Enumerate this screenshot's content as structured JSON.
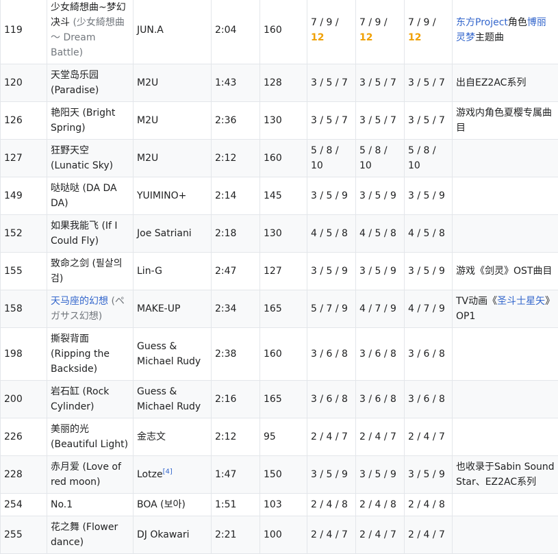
{
  "rows": [
    {
      "no": "119",
      "title": "少女綺想曲~梦幻决斗",
      "sub": "(少女綺想曲 ～ Dream Battle)",
      "link": false,
      "artist": "JUN.A",
      "ref": "",
      "time": "2:04",
      "bpm": "160",
      "diff1": "7 / 9 /",
      "diff1b": "12",
      "diff2": "7 / 9 /",
      "diff2b": "12",
      "diff3": "7 / 9 /",
      "diff3b": "12",
      "note_a": "东方Project",
      "note_b": "角色",
      "note_c": "博丽灵梦",
      "note_d": "主题曲"
    },
    {
      "no": "120",
      "title": "天堂岛乐园",
      "sub": "(Paradise)",
      "link": false,
      "artist": "M2U",
      "ref": "",
      "time": "1:43",
      "bpm": "128",
      "diff1": "3 / 5 / 7",
      "diff1b": "",
      "diff2": "3 / 5 / 7",
      "diff2b": "",
      "diff3": "3 / 5 / 7",
      "diff3b": "",
      "note_a": "",
      "note_b": "出自EZ2AC系列",
      "note_c": "",
      "note_d": ""
    },
    {
      "no": "126",
      "title": "艳阳天",
      "sub": "(Bright Spring)",
      "link": false,
      "artist": "M2U",
      "ref": "",
      "time": "2:36",
      "bpm": "130",
      "diff1": "3 / 5 / 7",
      "diff1b": "",
      "diff2": "3 / 5 / 7",
      "diff2b": "",
      "diff3": "3 / 5 / 7",
      "diff3b": "",
      "note_a": "",
      "note_b": "游戏内角色夏樱专属曲目",
      "note_c": "",
      "note_d": ""
    },
    {
      "no": "127",
      "title": "狂野天空",
      "sub": "(Lunatic Sky)",
      "link": false,
      "artist": "M2U",
      "ref": "",
      "time": "2:12",
      "bpm": "160",
      "diff1": "5 / 8 / 10",
      "diff1b": "",
      "diff2": "5 / 8 / 10",
      "diff2b": "",
      "diff3": "5 / 8 / 10",
      "diff3b": "",
      "note_a": "",
      "note_b": "",
      "note_c": "",
      "note_d": ""
    },
    {
      "no": "149",
      "title": "哒哒哒",
      "sub": "(DA DA DA)",
      "link": false,
      "artist": "YUIMINO+",
      "ref": "",
      "time": "2:14",
      "bpm": "145",
      "diff1": "3 / 5 / 9",
      "diff1b": "",
      "diff2": "3 / 5 / 9",
      "diff2b": "",
      "diff3": "3 / 5 / 9",
      "diff3b": "",
      "note_a": "",
      "note_b": "",
      "note_c": "",
      "note_d": ""
    },
    {
      "no": "152",
      "title": "如果我能飞",
      "sub": "(If I Could Fly)",
      "link": false,
      "artist": "Joe Satriani",
      "ref": "",
      "time": "2:18",
      "bpm": "130",
      "diff1": "4 / 5 / 8",
      "diff1b": "",
      "diff2": "4 / 5 / 8",
      "diff2b": "",
      "diff3": "4 / 5 / 8",
      "diff3b": "",
      "note_a": "",
      "note_b": "",
      "note_c": "",
      "note_d": ""
    },
    {
      "no": "155",
      "title": "致命之剑",
      "sub": "(필살의 검)",
      "link": false,
      "artist": "Lin-G",
      "ref": "",
      "time": "2:47",
      "bpm": "127",
      "diff1": "3 / 5 / 9",
      "diff1b": "",
      "diff2": "3 / 5 / 9",
      "diff2b": "",
      "diff3": "3 / 5 / 9",
      "diff3b": "",
      "note_a": "",
      "note_b": "游戏《剑灵》OST曲目",
      "note_c": "",
      "note_d": ""
    },
    {
      "no": "158",
      "title": "天马座的幻想",
      "sub": "(ペガサス幻想)",
      "link": true,
      "artist": "MAKE-UP",
      "ref": "",
      "time": "2:34",
      "bpm": "165",
      "diff1": "5 / 7 / 9",
      "diff1b": "",
      "diff2": "4 / 7 / 9",
      "diff2b": "",
      "diff3": "4 / 7 / 9",
      "diff3b": "",
      "note_a": "",
      "note_b": "TV动画《",
      "note_c": "圣斗士星矢",
      "note_d": "》OP1"
    },
    {
      "no": "198",
      "title": "撕裂背面",
      "sub": "(Ripping the Backside)",
      "link": false,
      "artist": "Guess & Michael Rudy",
      "ref": "",
      "time": "2:38",
      "bpm": "160",
      "diff1": "3 / 6 / 8",
      "diff1b": "",
      "diff2": "3 / 6 / 8",
      "diff2b": "",
      "diff3": "3 / 6 / 8",
      "diff3b": "",
      "note_a": "",
      "note_b": "",
      "note_c": "",
      "note_d": ""
    },
    {
      "no": "200",
      "title": "岩石缸",
      "sub": "(Rock Cylinder)",
      "link": false,
      "artist": "Guess & Michael Rudy",
      "ref": "",
      "time": "2:16",
      "bpm": "165",
      "diff1": "3 / 6 / 8",
      "diff1b": "",
      "diff2": "3 / 6 / 8",
      "diff2b": "",
      "diff3": "3 / 6 / 8",
      "diff3b": "",
      "note_a": "",
      "note_b": "",
      "note_c": "",
      "note_d": ""
    },
    {
      "no": "226",
      "title": "美丽的光",
      "sub": "(Beautiful Light)",
      "link": false,
      "artist": "金志文",
      "ref": "",
      "time": "2:12",
      "bpm": "95",
      "diff1": "2 / 4 / 7",
      "diff1b": "",
      "diff2": "2 / 4 / 7",
      "diff2b": "",
      "diff3": "2 / 4 / 7",
      "diff3b": "",
      "note_a": "",
      "note_b": "",
      "note_c": "",
      "note_d": ""
    },
    {
      "no": "228",
      "title": "赤月爱",
      "sub": "(Love of red moon)",
      "link": false,
      "artist": "Lotze",
      "ref": "[4]",
      "time": "1:47",
      "bpm": "150",
      "diff1": "3 / 5 / 9",
      "diff1b": "",
      "diff2": "3 / 5 / 9",
      "diff2b": "",
      "diff3": "3 / 5 / 9",
      "diff3b": "",
      "note_a": "",
      "note_b": "也收录于Sabin Sound Star、EZ2AC系列",
      "note_c": "",
      "note_d": ""
    },
    {
      "no": "254",
      "title": "No.1",
      "sub": "",
      "link": false,
      "artist": "BOA (보아)",
      "ref": "",
      "time": "1:51",
      "bpm": "103",
      "diff1": "2 / 4 / 8",
      "diff1b": "",
      "diff2": "2 / 4 / 8",
      "diff2b": "",
      "diff3": "2 / 4 / 8",
      "diff3b": "",
      "note_a": "",
      "note_b": "",
      "note_c": "",
      "note_d": ""
    },
    {
      "no": "255",
      "title": "花之舞",
      "sub": "(Flower dance)",
      "link": false,
      "artist": "DJ Okawari",
      "ref": "",
      "time": "2:21",
      "bpm": "100",
      "diff1": "2 / 4 / 7",
      "diff1b": "",
      "diff2": "2 / 4 / 7",
      "diff2b": "",
      "diff3": "2 / 4 / 7",
      "diff3b": "",
      "note_a": "",
      "note_b": "",
      "note_c": "",
      "note_d": ""
    }
  ]
}
